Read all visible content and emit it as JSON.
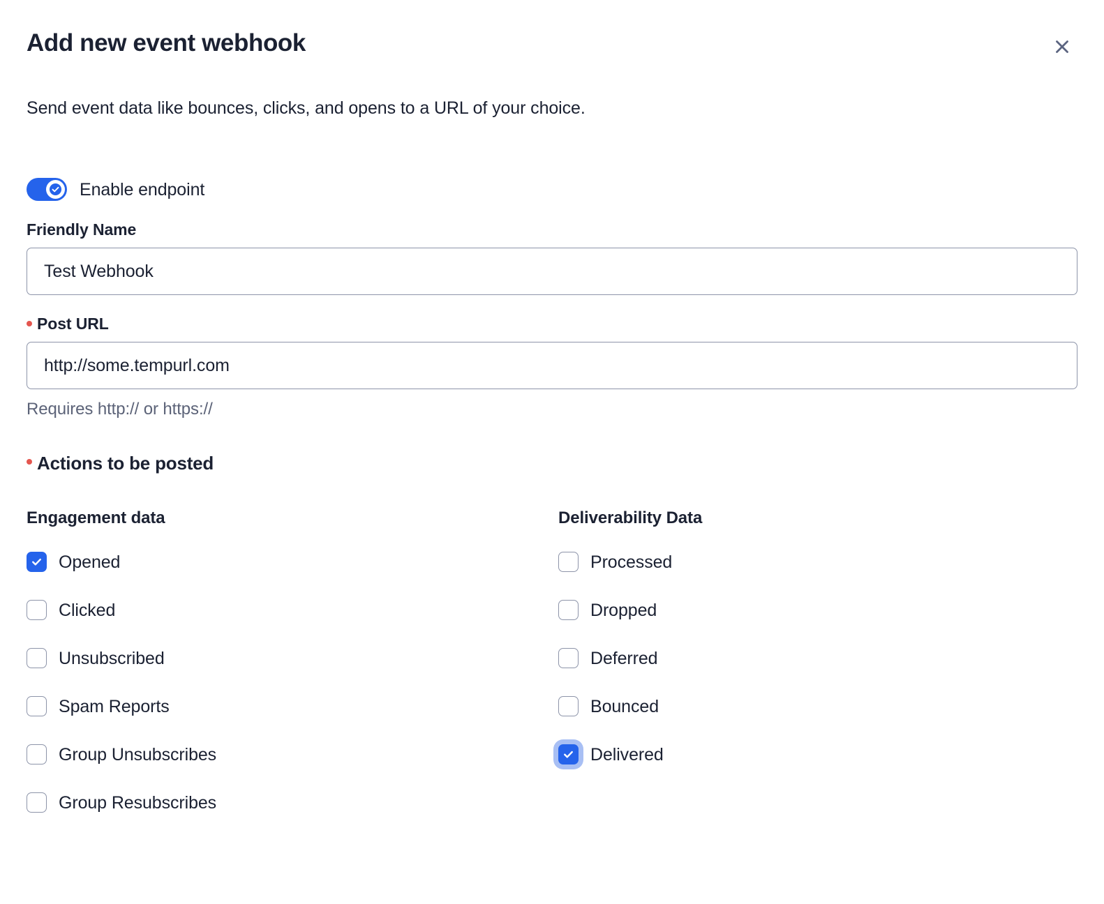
{
  "dialog": {
    "title": "Add new event webhook",
    "description": "Send event data like bounces, clicks, and opens to a URL of your choice.",
    "close_label": "Close"
  },
  "enable_endpoint": {
    "label": "Enable endpoint",
    "enabled": true
  },
  "fields": {
    "friendly_name": {
      "label": "Friendly Name",
      "value": "Test Webhook",
      "placeholder": "",
      "required": false
    },
    "post_url": {
      "label": "Post URL",
      "value": "http://some.tempurl.com",
      "placeholder": "",
      "required": true,
      "helper": "Requires http:// or https://"
    }
  },
  "actions_section": {
    "title": "Actions to be posted",
    "required": true,
    "columns": [
      {
        "title": "Engagement data",
        "items": [
          {
            "label": "Opened",
            "checked": true,
            "focused": false
          },
          {
            "label": "Clicked",
            "checked": false,
            "focused": false
          },
          {
            "label": "Unsubscribed",
            "checked": false,
            "focused": false
          },
          {
            "label": "Spam Reports",
            "checked": false,
            "focused": false
          },
          {
            "label": "Group Unsubscribes",
            "checked": false,
            "focused": false
          },
          {
            "label": "Group Resubscribes",
            "checked": false,
            "focused": false
          }
        ]
      },
      {
        "title": "Deliverability Data",
        "items": [
          {
            "label": "Processed",
            "checked": false,
            "focused": false
          },
          {
            "label": "Dropped",
            "checked": false,
            "focused": false
          },
          {
            "label": "Deferred",
            "checked": false,
            "focused": false
          },
          {
            "label": "Bounced",
            "checked": false,
            "focused": false
          },
          {
            "label": "Delivered",
            "checked": true,
            "focused": true
          }
        ]
      }
    ]
  },
  "colors": {
    "accent": "#2563eb",
    "required_dot": "#e4564f",
    "text": "#1b2132",
    "muted_text": "#5c6378",
    "border": "#8d94a9",
    "focus_ring": "#608beb"
  }
}
